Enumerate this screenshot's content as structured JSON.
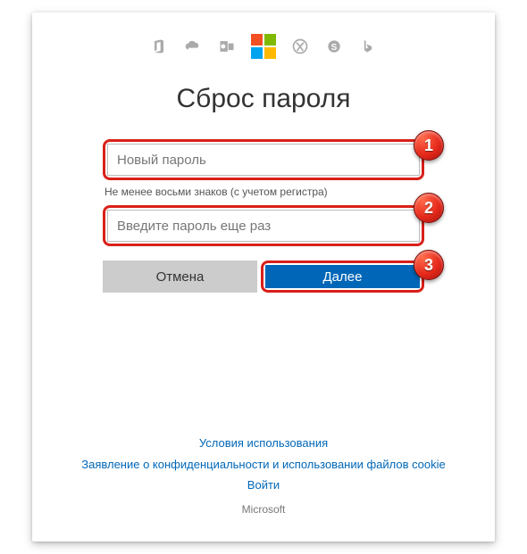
{
  "title": "Сброс пароля",
  "form": {
    "new_password_placeholder": "Новый пароль",
    "hint": "Не менее восьми знаков (с учетом регистра)",
    "confirm_password_placeholder": "Введите пароль еще раз",
    "cancel_label": "Отмена",
    "next_label": "Далее"
  },
  "badges": {
    "one": "1",
    "two": "2",
    "three": "3"
  },
  "footer": {
    "terms": "Условия использования",
    "privacy": "Заявление о конфиденциальности и использовании файлов cookie",
    "signin": "Войти",
    "copyright": "Microsoft"
  }
}
